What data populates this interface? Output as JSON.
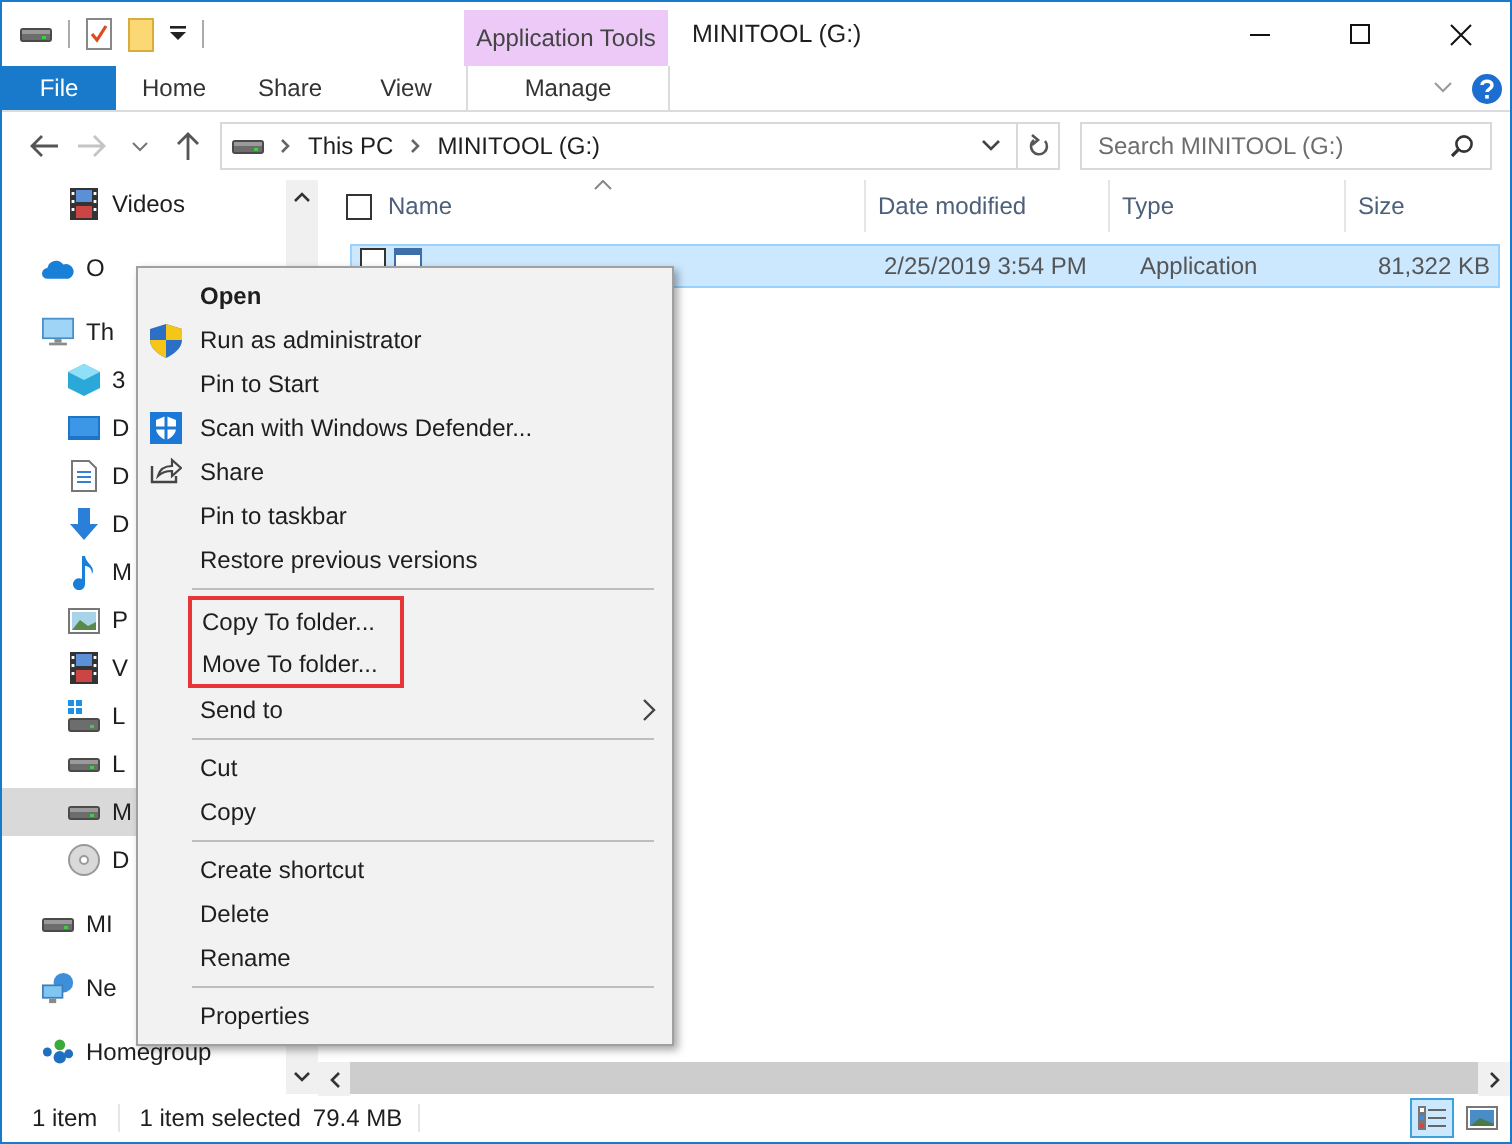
{
  "window": {
    "title": "MINITOOL (G:)",
    "contextual_group": "Application Tools"
  },
  "ribbon_tabs": [
    {
      "label": "File",
      "kind": "file"
    },
    {
      "label": "Home",
      "kind": "tab"
    },
    {
      "label": "Share",
      "kind": "tab"
    },
    {
      "label": "View",
      "kind": "tab"
    },
    {
      "label": "Manage",
      "kind": "contextual"
    }
  ],
  "address_bar": {
    "path": [
      "This PC",
      "MINITOOL (G:)"
    ]
  },
  "search": {
    "placeholder": "Search MINITOOL (G:)"
  },
  "nav_pane": {
    "continued_children": [
      {
        "label": "Videos",
        "kind": "film",
        "selected": false
      }
    ],
    "items": [
      {
        "label": "O",
        "kind": "cloud",
        "selected": false
      },
      {
        "label": "Th",
        "kind": "pc",
        "selected": false,
        "children": [
          {
            "label": "3",
            "kind": "cube",
            "selected": false
          },
          {
            "label": "D",
            "kind": "desktop",
            "selected": false
          },
          {
            "label": "D",
            "kind": "document",
            "selected": false
          },
          {
            "label": "D",
            "kind": "download",
            "selected": false
          },
          {
            "label": "M",
            "kind": "music",
            "selected": false
          },
          {
            "label": "P",
            "kind": "pictures",
            "selected": false
          },
          {
            "label": "V",
            "kind": "film",
            "selected": false
          },
          {
            "label": "L",
            "kind": "drive_win",
            "selected": false
          },
          {
            "label": "L",
            "kind": "drive",
            "selected": false
          },
          {
            "label": "M",
            "kind": "drive",
            "selected": true
          },
          {
            "label": "D",
            "kind": "disc",
            "selected": false
          }
        ]
      },
      {
        "label": "MI",
        "kind": "drive",
        "selected": false
      },
      {
        "label": "Ne",
        "kind": "network",
        "selected": false
      },
      {
        "label": "Homegroup",
        "kind": "homegroup",
        "selected": false
      }
    ]
  },
  "file_list": {
    "select_all": {
      "checked": false
    },
    "columns": [
      {
        "label": "Name",
        "sorted": true
      },
      {
        "label": "Date modified",
        "sorted": false
      },
      {
        "label": "Type",
        "sorted": false
      },
      {
        "label": "Size",
        "sorted": false
      }
    ],
    "rows": [
      {
        "date_modified": "2/25/2019 3:54 PM",
        "type": "Application",
        "size": "81,322 KB",
        "selected": true
      }
    ]
  },
  "context_menu": {
    "entries": [
      {
        "kind": "item",
        "label": "Open",
        "default": true
      },
      {
        "kind": "admin",
        "label": "Run as administrator"
      },
      {
        "kind": "item",
        "label": "Pin to Start"
      },
      {
        "kind": "scan",
        "label": "Scan with Windows Defender..."
      },
      {
        "kind": "share",
        "label": "Share"
      },
      {
        "kind": "item",
        "label": "Pin to taskbar"
      },
      {
        "kind": "item",
        "label": "Restore previous versions"
      },
      {
        "kind": "separator"
      },
      {
        "kind": "framed",
        "items": [
          {
            "kind": "item",
            "label": "Copy To folder..."
          },
          {
            "kind": "item",
            "label": "Move To folder..."
          }
        ]
      },
      {
        "kind": "item",
        "label": "Send to",
        "submenu": true
      },
      {
        "kind": "separator"
      },
      {
        "kind": "item",
        "label": "Cut"
      },
      {
        "kind": "item",
        "label": "Copy"
      },
      {
        "kind": "separator"
      },
      {
        "kind": "item",
        "label": "Create shortcut"
      },
      {
        "kind": "item",
        "label": "Delete"
      },
      {
        "kind": "item",
        "label": "Rename"
      },
      {
        "kind": "separator"
      },
      {
        "kind": "item",
        "label": "Properties"
      }
    ]
  },
  "status_bar": {
    "item_count": "1 item",
    "selection": "1 item selected",
    "selection_size": "79.4 MB",
    "view_buttons": [
      {
        "kind": "details",
        "selected": true
      },
      {
        "kind": "large_icons",
        "selected": false
      }
    ]
  }
}
